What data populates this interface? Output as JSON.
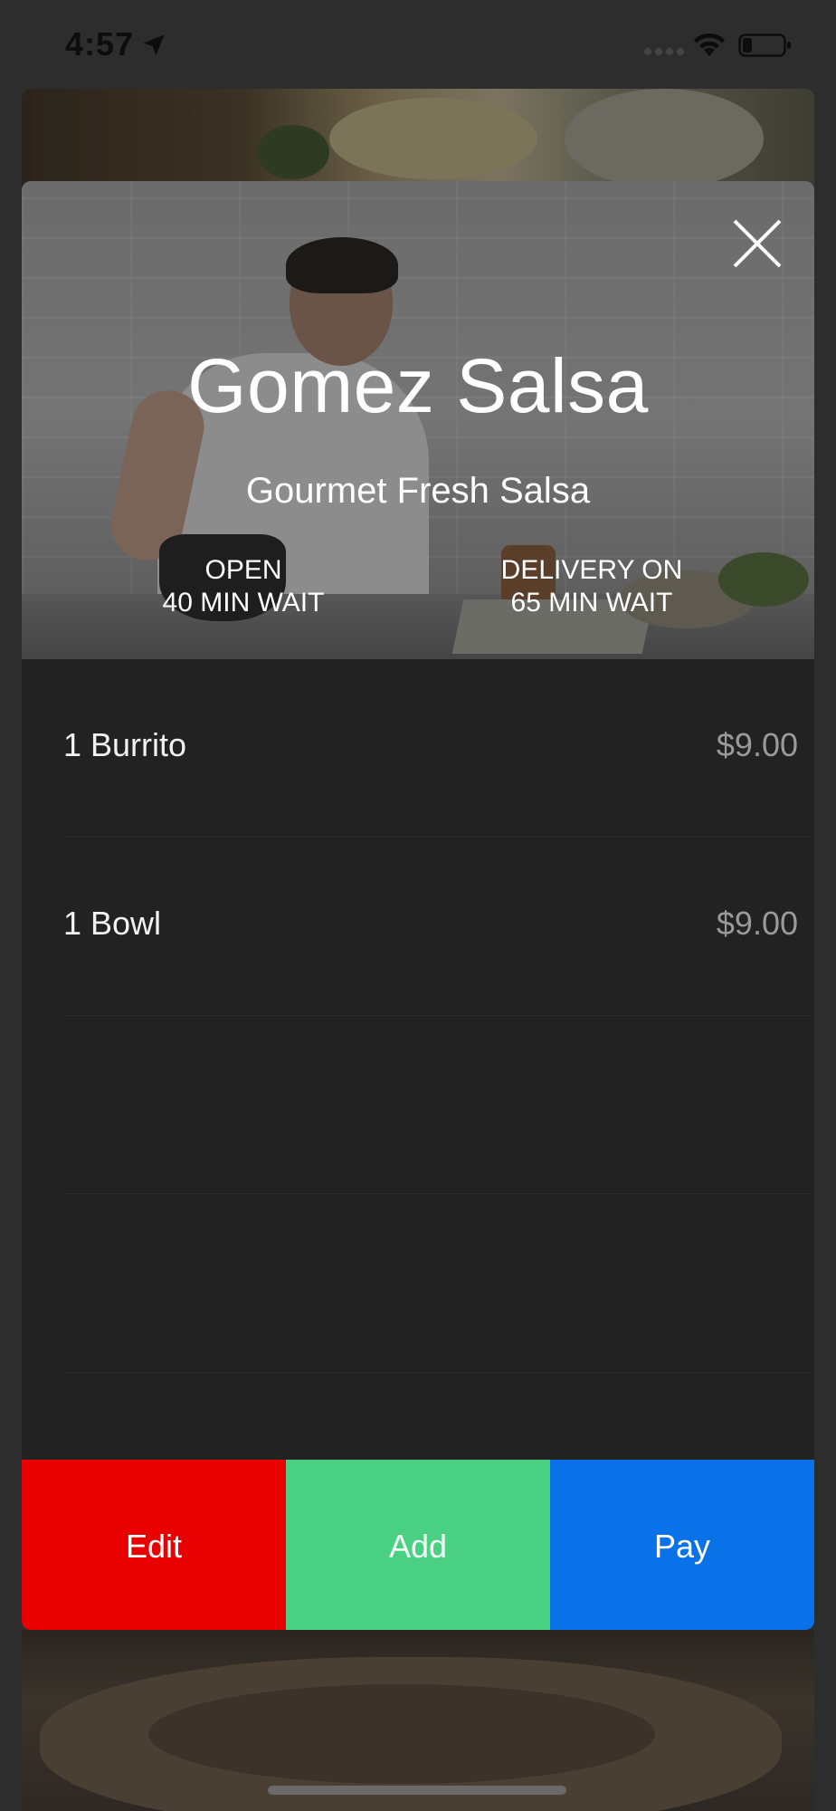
{
  "status_bar": {
    "time": "4:57",
    "icons": [
      "location-arrow-icon",
      "signal-icon",
      "wifi-icon",
      "battery-icon"
    ]
  },
  "vendor": {
    "name": "Gomez Salsa",
    "tagline": "Gourmet Fresh Salsa",
    "pickup_status": "OPEN",
    "pickup_wait": "40 MIN WAIT",
    "delivery_status": "DELIVERY ON",
    "delivery_wait": "65 MIN WAIT",
    "close_icon": "close-icon"
  },
  "order": {
    "items": [
      {
        "name": "1 Burrito",
        "price": "$9.00"
      },
      {
        "name": "1 Bowl",
        "price": "$9.00"
      }
    ]
  },
  "actions": {
    "edit_label": "Edit",
    "add_label": "Add",
    "pay_label": "Pay"
  },
  "colors": {
    "edit": "#e90000",
    "add": "#4ad083",
    "pay": "#0a72e8",
    "modal_background": "#222222"
  }
}
